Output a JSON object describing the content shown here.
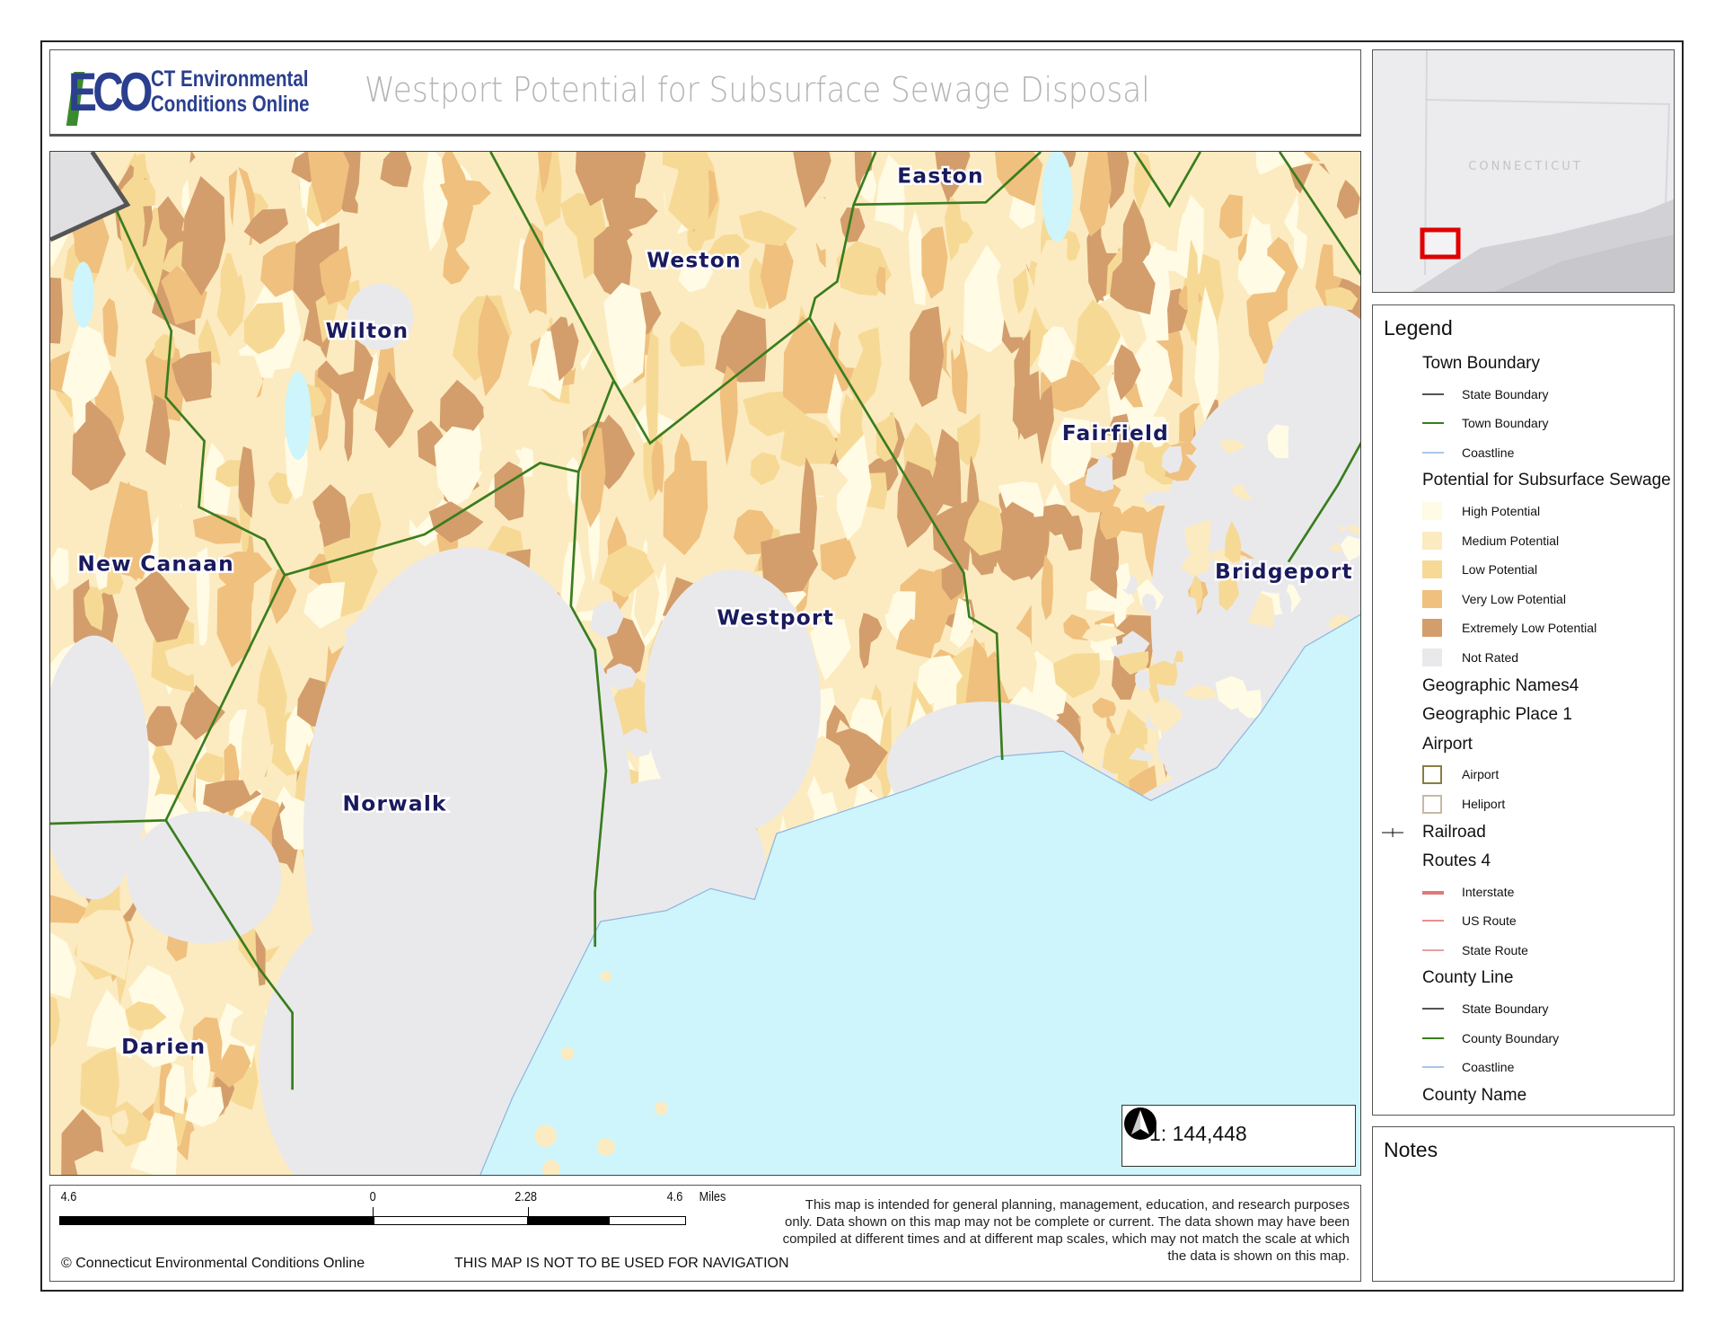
{
  "header": {
    "logo_mark": "ECO",
    "logo_line1": "CT Environmental",
    "logo_line2": "Conditions Online",
    "title": "Westport Potential for Subsurface Sewage Disposal"
  },
  "inset": {
    "label": "CONNECTICUT",
    "extent_color": "#e00000"
  },
  "map": {
    "places": [
      "Easton",
      "Weston",
      "Wilton",
      "Fairfield",
      "New Canaan",
      "Bridgeport",
      "Westport",
      "Norwalk",
      "Darien"
    ],
    "scale_text": "1: 144,448",
    "north_arrow_icon": "north-arrow-icon",
    "colors": {
      "water": "#cdf5fb",
      "town_boundary": "#3a7d1e",
      "state_boundary": "#555555"
    }
  },
  "legend": {
    "title": "Legend",
    "rows": [
      {
        "type": "h",
        "label": "Town Boundary"
      },
      {
        "type": "line",
        "label": "State Boundary",
        "color": "#555555"
      },
      {
        "type": "line",
        "label": "Town Boundary",
        "color": "#3a7d1e"
      },
      {
        "type": "line",
        "label": "Coastline",
        "color": "#a9c7e6"
      },
      {
        "type": "h",
        "label": "Potential for Subsurface Sewage Disposal"
      },
      {
        "type": "fill",
        "label": "High Potential",
        "color": "#fffbe4"
      },
      {
        "type": "fill",
        "label": "Medium Potential",
        "color": "#fcebc0"
      },
      {
        "type": "fill",
        "label": "Low Potential",
        "color": "#f7d996"
      },
      {
        "type": "fill",
        "label": "Very Low Potential",
        "color": "#f0c07e"
      },
      {
        "type": "fill",
        "label": "Extremely Low Potential",
        "color": "#d39e6c"
      },
      {
        "type": "fill",
        "label": "Not Rated",
        "color": "#e9e9ec"
      },
      {
        "type": "h",
        "label": "Geographic Names4"
      },
      {
        "type": "h",
        "label": "Geographic Place 1"
      },
      {
        "type": "h",
        "label": "Airport"
      },
      {
        "type": "sq",
        "label": "Airport",
        "color": "#8a7d45"
      },
      {
        "type": "sq",
        "label": "Heliport",
        "color": "#c8b8a4"
      },
      {
        "type": "rail",
        "label": "Railroad"
      },
      {
        "type": "h",
        "label": "Routes 4"
      },
      {
        "type": "line",
        "label": "Interstate",
        "color": "#e07a7a",
        "thick": true
      },
      {
        "type": "line",
        "label": "US Route",
        "color": "#e89090"
      },
      {
        "type": "line",
        "label": "State Route",
        "color": "#e8a0a0"
      },
      {
        "type": "h",
        "label": "County Line"
      },
      {
        "type": "line",
        "label": "State Boundary",
        "color": "#555555"
      },
      {
        "type": "line",
        "label": "County Boundary",
        "color": "#3a7d1e"
      },
      {
        "type": "line",
        "label": "Coastline",
        "color": "#a9c7e6"
      },
      {
        "type": "h",
        "label": "County Name"
      }
    ]
  },
  "notes": {
    "title": "Notes"
  },
  "footer": {
    "scale_labels": [
      "4.6",
      "0",
      "2.28",
      "4.6"
    ],
    "scale_unit": "Miles",
    "disclaimer": "This map is intended for general planning, management, education, and research purposes only. Data shown on this map may not be complete or current. The data shown may have been compiled at different times and at different map scales, which may not match the scale at which the data is shown on this map.",
    "copyright": "© Connecticut Environmental Conditions Online",
    "navigation_warning": "THIS MAP IS NOT TO BE USED FOR NAVIGATION"
  }
}
